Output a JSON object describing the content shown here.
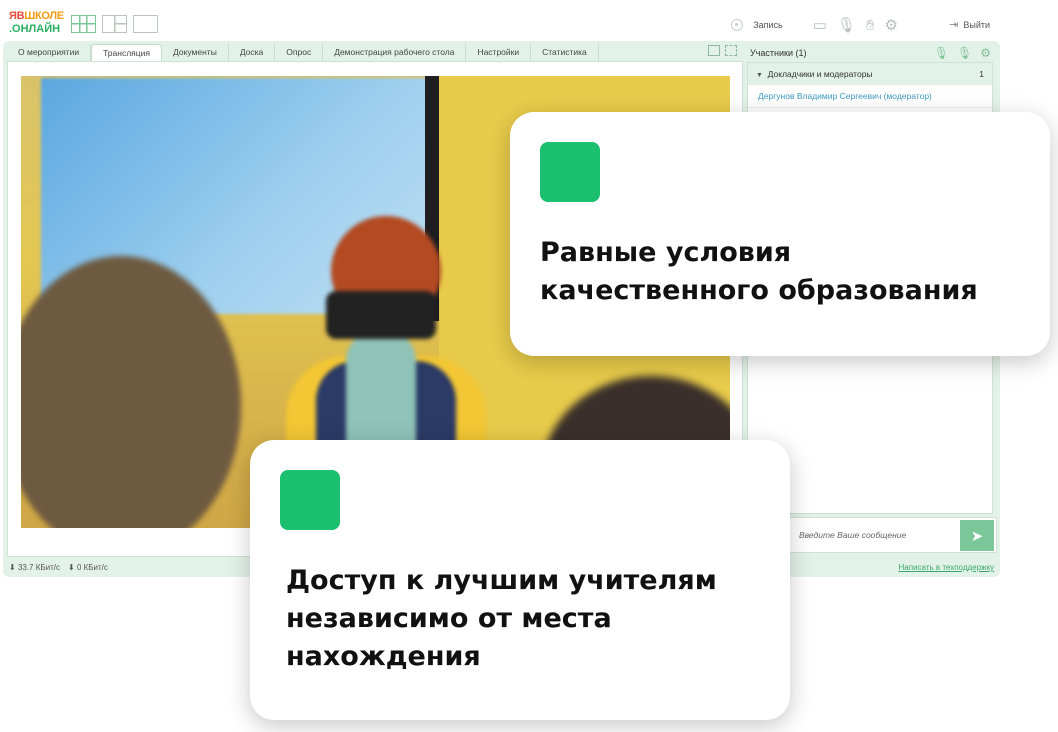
{
  "logo": {
    "line1_a": "ЯВ",
    "line1_b": "ШКОЛЕ",
    "line2": ".ОНЛАЙН"
  },
  "toolbar": {
    "record_label": "Запись",
    "exit_label": "Выйти"
  },
  "tabs": [
    {
      "label": "О мероприятии",
      "active": false
    },
    {
      "label": "Трансляция",
      "active": true
    },
    {
      "label": "Документы",
      "active": false
    },
    {
      "label": "Доска",
      "active": false
    },
    {
      "label": "Опрос",
      "active": false
    },
    {
      "label": "Демонстрация рабочего стола",
      "active": false
    },
    {
      "label": "Настройки",
      "active": false
    },
    {
      "label": "Статистика",
      "active": false
    }
  ],
  "participants": {
    "title": "Участники (1)",
    "group_label": "Докладчики и модераторы",
    "group_count": "1",
    "member": "Дергунов Владимир Сергеевич (модератор)"
  },
  "message": {
    "placeholder": "Введите Ваше сообщение"
  },
  "status": {
    "down": "33.7 КБит/с",
    "up": "0 КБит/с",
    "support_link": "Написать в техподдержку"
  },
  "cards": {
    "card1_line1": "Равные условия",
    "card1_line2": "качественного образования",
    "card2_line1": "Доступ к лучшим учителям",
    "card2_line2": "независимо от места",
    "card2_line3": "нахождения"
  },
  "colors": {
    "accent": "#1bc06f",
    "frame": "#e3f2e8",
    "link": "#3f9cc2"
  }
}
